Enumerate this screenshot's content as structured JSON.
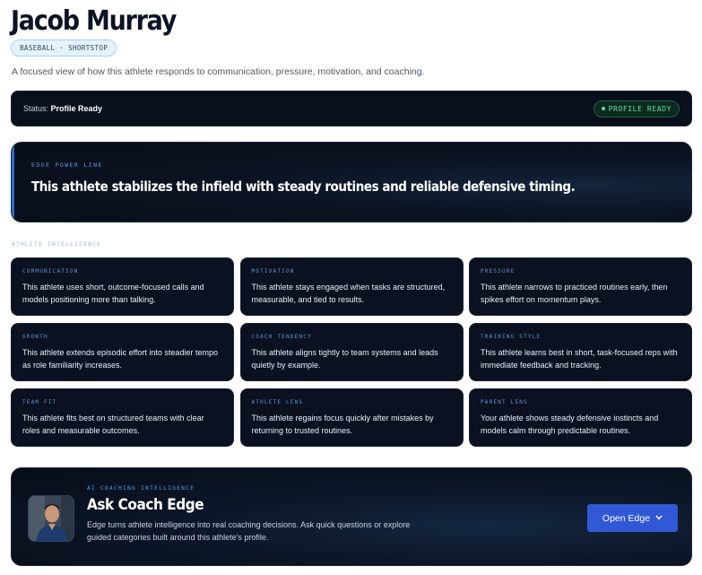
{
  "athlete": {
    "name": "Jacob Murray",
    "sport_badge": "BASEBALL · SHORTSTOP",
    "description": "A focused view of how this athlete responds to communication, pressure, motivation, and coaching."
  },
  "status": {
    "label": "Status:",
    "value": "Profile Ready",
    "pill": "PROFILE READY",
    "pill_color": "#5fe3a0"
  },
  "power_line": {
    "label": "EDGE POWER LINE",
    "text": "This athlete stabilizes the infield with steady routines and reliable defensive timing."
  },
  "intelligence": {
    "section_label": "ATHLETE INTELLIGENCE",
    "cards": [
      {
        "label": "COMMUNICATION",
        "text": "This athlete uses short, outcome-focused calls and models positioning more than talking."
      },
      {
        "label": "MOTIVATION",
        "text": "This athlete stays engaged when tasks are structured, measurable, and tied to results."
      },
      {
        "label": "PRESSURE",
        "text": "This athlete narrows to practiced routines early, then spikes effort on momentum plays."
      },
      {
        "label": "GROWTH",
        "text": "This athlete extends episodic effort into steadier tempo as role familiarity increases."
      },
      {
        "label": "COACH TENDENCY",
        "text": "This athlete aligns tightly to team systems and leads quietly by example."
      },
      {
        "label": "TRAINING STYLE",
        "text": "This athlete learns best in short, task-focused reps with immediate feedback and tracking."
      },
      {
        "label": "TEAM FIT",
        "text": "This athlete fits best on structured teams with clear roles and measurable outcomes."
      },
      {
        "label": "ATHLETE LENS",
        "text": "This athlete regains focus quickly after mistakes by returning to trusted routines."
      },
      {
        "label": "PARENT LENS",
        "text": "Your athlete shows steady defensive instincts and models calm through predictable routines."
      }
    ]
  },
  "coach": {
    "label": "AI COACHING INTELLIGENCE",
    "title": "Ask Coach Edge",
    "description": "Edge turns athlete intelligence into real coaching decisions. Ask quick questions or explore guided categories built around this athlete's profile.",
    "button_label": "Open Edge",
    "button_icon": "chevron-down-icon",
    "avatar_icon": "coach-avatar",
    "accent_color": "#3158d6"
  }
}
